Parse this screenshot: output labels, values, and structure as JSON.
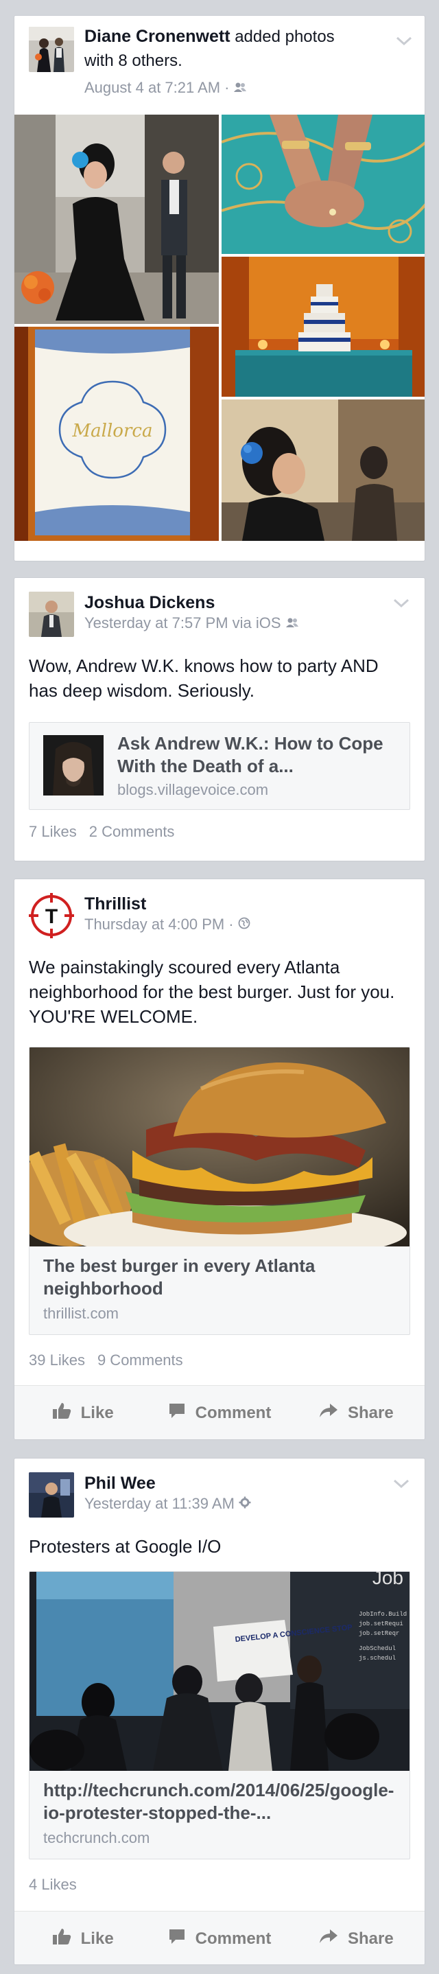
{
  "posts": [
    {
      "author": "Diane Cronenwett",
      "action": " added photos with 8 others.",
      "time": "August 4 at 7:21 AM",
      "privacy_icon": "friends-icon"
    },
    {
      "author": "Joshua Dickens",
      "time": "Yesterday at 7:57 PM via iOS",
      "privacy_icon": "friends-icon",
      "text": "Wow, Andrew W.K. knows how to party AND has deep wisdom. Seriously.",
      "link": {
        "title": "Ask Andrew W.K.: How to Cope With the Death of a...",
        "domain": "blogs.villagevoice.com"
      },
      "likes": "7 Likes",
      "comments": "2 Comments"
    },
    {
      "author": "Thrillist",
      "time": "Thursday at 4:00 PM",
      "privacy_icon": "globe-icon",
      "text": "We painstakingly scoured every Atlanta neighborhood for the best burger. Just for you. YOU'RE WELCOME.",
      "link": {
        "title": "The best burger in every Atlanta neighborhood",
        "domain": "thrillist.com"
      },
      "likes": "39 Likes",
      "comments": "9 Comments"
    },
    {
      "author": "Phil Wee",
      "time": "Yesterday at 11:39 AM",
      "privacy_icon": "gear-icon",
      "text": "Protesters at Google I/O",
      "link": {
        "title": "http://techcrunch.com/2014/06/25/google-io-protester-stopped-the-...",
        "domain": "techcrunch.com"
      },
      "likes": "4 Likes"
    }
  ],
  "actions": {
    "like": "Like",
    "comment": "Comment",
    "share": "Share"
  },
  "photo_text": {
    "card_script": "Mallorca",
    "sign": "DEVELOP A CONSCIENCE STOP"
  },
  "colors": {
    "background": "#d3d6db",
    "text_primary": "#141823",
    "text_secondary": "#9197a3",
    "action_text": "#7f7f7f"
  }
}
